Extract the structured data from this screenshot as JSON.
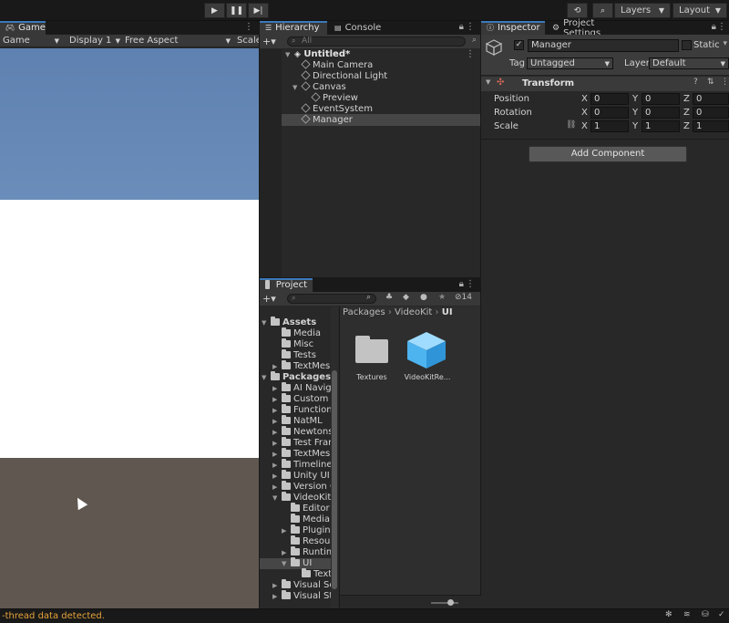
{
  "toolbar": {
    "play_icon": "play-icon",
    "pause_icon": "pause-icon",
    "step_icon": "step-icon",
    "history_icon": "history-icon",
    "search_icon": "search-icon",
    "layers_label": "Layers",
    "layout_label": "Layout"
  },
  "game": {
    "tab_label": "Game",
    "mode_value": "Game",
    "display_value": "Display 1",
    "aspect_value": "Free Aspect",
    "scale_label": "Scale",
    "colors": {
      "sky": "#6385b4",
      "white": "#ffffff",
      "ground": "#605850"
    }
  },
  "hierarchy": {
    "tab_label": "Hierarchy",
    "console_tab_label": "Console",
    "search_placeholder": "All",
    "scene_name": "Untitled*",
    "items": [
      {
        "label": "Main Camera"
      },
      {
        "label": "Directional Light"
      },
      {
        "label": "Canvas"
      },
      {
        "label": "Preview"
      },
      {
        "label": "EventSystem"
      },
      {
        "label": "Manager"
      }
    ]
  },
  "project": {
    "tab_label": "Project",
    "hidden_count": "14",
    "breadcrumb": [
      "Packages",
      "VideoKit",
      "UI"
    ],
    "tree": [
      {
        "label": "Assets"
      },
      {
        "label": "Media"
      },
      {
        "label": "Misc"
      },
      {
        "label": "Tests"
      },
      {
        "label": "TextMesh"
      },
      {
        "label": "Packages"
      },
      {
        "label": "AI Naviga"
      },
      {
        "label": "Custom N"
      },
      {
        "label": "Function"
      },
      {
        "label": "NatML"
      },
      {
        "label": "Newtonsc"
      },
      {
        "label": "Test Fram"
      },
      {
        "label": "TextMesh"
      },
      {
        "label": "Timeline"
      },
      {
        "label": "Unity UI"
      },
      {
        "label": "Version C"
      },
      {
        "label": "VideoKit"
      },
      {
        "label": "Editor"
      },
      {
        "label": "Media"
      },
      {
        "label": "Plugins"
      },
      {
        "label": "Resour"
      },
      {
        "label": "Runtim"
      },
      {
        "label": "UI"
      },
      {
        "label": "Text"
      },
      {
        "label": "Visual Sc"
      },
      {
        "label": "Visual Stu"
      }
    ],
    "assets": [
      {
        "label": "Textures"
      },
      {
        "label": "VideoKitRe..."
      }
    ]
  },
  "inspector": {
    "tab_label": "Inspector",
    "settings_tab_label": "Project Settings",
    "object_name": "Manager",
    "static_label": "Static",
    "tag_label": "Tag",
    "tag_value": "Untagged",
    "layer_label": "Layer",
    "layer_value": "Default",
    "transform_title": "Transform",
    "position_label": "Position",
    "rotation_label": "Rotation",
    "scale_label": "Scale",
    "x": "X",
    "y": "Y",
    "z": "Z",
    "position": [
      "0",
      "0",
      "0"
    ],
    "rotation": [
      "0",
      "0",
      "0"
    ],
    "scale": [
      "1",
      "1",
      "1"
    ],
    "add_component_label": "Add Component"
  },
  "status": {
    "message": "-thread data detected."
  }
}
